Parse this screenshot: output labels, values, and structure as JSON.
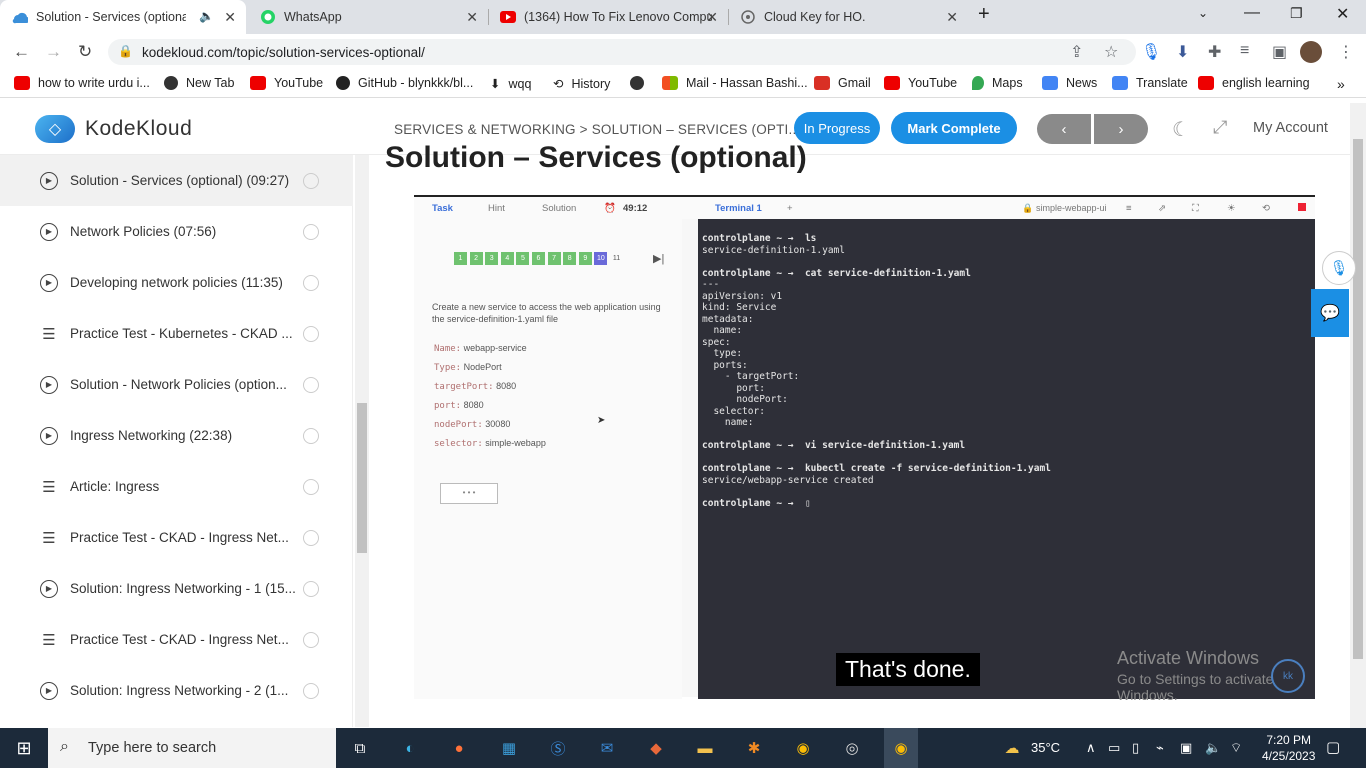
{
  "browser": {
    "tabs": [
      {
        "title": "Solution - Services (optional)",
        "icon": "kodekloud-icon",
        "active": true
      },
      {
        "title": "WhatsApp",
        "icon": "whatsapp-icon"
      },
      {
        "title": "(1364) How To Fix Lenovo Compu",
        "icon": "youtube-icon"
      },
      {
        "title": "Cloud Key for HO.",
        "icon": "chatgpt-icon"
      }
    ],
    "url": "kodekloud.com/topic/solution-services-optional/",
    "bookmarks": [
      {
        "label": "how to write urdu i...",
        "icon": "youtube-icon",
        "color": "#e00"
      },
      {
        "label": "New Tab",
        "icon": "globe-icon",
        "color": "#333"
      },
      {
        "label": "YouTube",
        "icon": "youtube-icon",
        "color": "#e00"
      },
      {
        "label": "GitHub - blynkkk/bl...",
        "icon": "github-icon",
        "color": "#222"
      },
      {
        "label": "wqq",
        "icon": "download-icon",
        "color": "#333"
      },
      {
        "label": "History",
        "icon": "history-icon",
        "color": "#333"
      },
      {
        "label": "",
        "icon": "globe-icon",
        "color": "#333"
      },
      {
        "label": "Mail - Hassan Bashi...",
        "icon": "microsoft-icon",
        "color": "#f25022"
      },
      {
        "label": "Gmail",
        "icon": "gmail-icon",
        "color": "#d93025"
      },
      {
        "label": "YouTube",
        "icon": "youtube-icon",
        "color": "#e00"
      },
      {
        "label": "Maps",
        "icon": "maps-icon",
        "color": "#34a853"
      },
      {
        "label": "News",
        "icon": "news-icon",
        "color": "#4285f4"
      },
      {
        "label": "Translate",
        "icon": "translate-icon",
        "color": "#4285f4"
      },
      {
        "label": "english learning",
        "icon": "youtube-icon",
        "color": "#e00"
      }
    ]
  },
  "header": {
    "logo": "KodeKloud",
    "breadcrumb": "SERVICES & NETWORKING > SOLUTION – SERVICES (OPTI...",
    "in_progress": "In Progress",
    "mark_complete": "Mark Complete",
    "account": "My Account",
    "accent": "#1b8fe4"
  },
  "sidebar": {
    "items": [
      {
        "label": "Solution - Services (optional) (09:27)",
        "type": "video",
        "current": true
      },
      {
        "label": "Network Policies (07:56)",
        "type": "video"
      },
      {
        "label": "Developing network policies (11:35)",
        "type": "video"
      },
      {
        "label": "Practice Test - Kubernetes - CKAD ...",
        "type": "lab"
      },
      {
        "label": "Solution - Network Policies (option...",
        "type": "video"
      },
      {
        "label": "Ingress Networking (22:38)",
        "type": "video"
      },
      {
        "label": "Article: Ingress",
        "type": "lab"
      },
      {
        "label": "Practice Test - CKAD - Ingress Net...",
        "type": "lab"
      },
      {
        "label": "Solution: Ingress Networking - 1 (15...",
        "type": "video"
      },
      {
        "label": "Practice Test - CKAD - Ingress Net...",
        "type": "lab"
      },
      {
        "label": "Solution: Ingress Networking - 2 (1...",
        "type": "video"
      }
    ]
  },
  "main": {
    "title": "Solution – Services (optional)",
    "video": {
      "tabs": {
        "task": "Task",
        "hint": "Hint",
        "solution": "Solution",
        "timer": "49:12",
        "terminal": "Terminal 1",
        "host": "simple-webapp-ui"
      },
      "questions": [
        "1",
        "2",
        "3",
        "4",
        "5",
        "6",
        "7",
        "8",
        "9",
        "10",
        "11"
      ],
      "task_text": "Create a new service to access the web application using the service-definition-1.yaml file",
      "fields": [
        {
          "k": "Name:",
          "v": "webapp-service"
        },
        {
          "k": "Type:",
          "v": "NodePort"
        },
        {
          "k": "targetPort:",
          "v": "8080"
        },
        {
          "k": "port:",
          "v": "8080"
        },
        {
          "k": "nodePort:",
          "v": "30080"
        },
        {
          "k": "selector:",
          "v": "simple-webapp"
        }
      ],
      "terminal_lines": [
        "controlplane ~ →  ls",
        "service-definition-1.yaml",
        "",
        "controlplane ~ →  cat service-definition-1.yaml",
        "---",
        "apiVersion: v1",
        "kind: Service",
        "metadata:",
        "  name:",
        "spec:",
        "  type:",
        "  ports:",
        "    - targetPort:",
        "      port:",
        "      nodePort:",
        "  selector:",
        "    name:",
        "",
        "controlplane ~ →  vi service-definition-1.yaml",
        "",
        "controlplane ~ →  kubectl create -f service-definition-1.yaml",
        "service/webapp-service created",
        "",
        "controlplane ~ →  ▯"
      ],
      "caption": "That's done.",
      "activate_title": "Activate Windows",
      "activate_sub": "Go to Settings to activate Windows."
    }
  },
  "taskbar": {
    "search": "Type here to search",
    "temp": "35°C",
    "time": "7:20 PM",
    "date": "4/25/2023"
  }
}
